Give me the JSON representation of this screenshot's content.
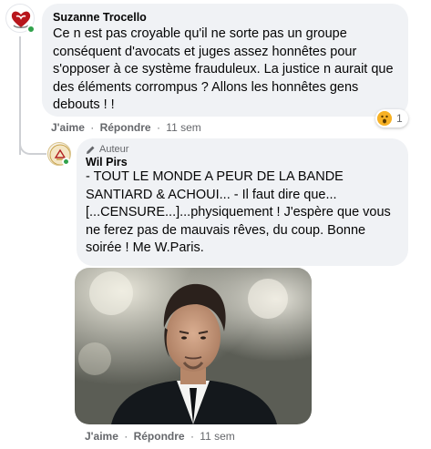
{
  "comment1": {
    "author": "Suzanne Trocello",
    "text": "Ce n est pas croyable qu'il ne sorte pas un groupe\nconséquent d'avocats et juges assez honnêtes pour\ns'opposer à ce système frauduleux. La justice n aurait que\ndes éléments corrompus ? Allons les honnêtes gens\ndebouts ! !",
    "like_label": "J'aime",
    "reply_label": "Répondre",
    "separator": "·",
    "time": "11 sem",
    "reaction_count": "1",
    "reaction_icon": "wow-emoji-icon"
  },
  "reply": {
    "badge_label": "Auteur",
    "badge_icon": "pencil-icon",
    "author": "Wil Pirs",
    "text": "- TOUT LE MONDE A PEUR DE LA BANDE\nSANTIARD & ACHOUI... - Il faut dire que...\n[...CENSURE...]...physiquement ! J'espère que vous\nne ferez pas de mauvais rêves, du coup. Bonne\nsoirée ! Me W.Paris.",
    "like_label": "J'aime",
    "reply_label": "Répondre",
    "separator": "·",
    "time": "11 sem"
  },
  "colors": {
    "bubble": "#f0f2f5",
    "meta_text": "#65676b",
    "online": "#31a24c"
  }
}
